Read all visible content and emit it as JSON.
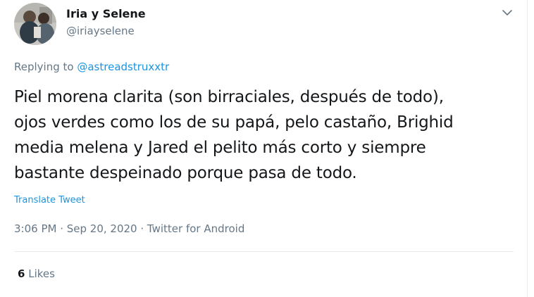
{
  "user": {
    "display_name": "Iria y Selene",
    "handle": "@iriayselene"
  },
  "reply": {
    "prefix": "Replying to",
    "mention": "@astreadstruxxtr"
  },
  "tweet": {
    "lines": [
      "Piel morena clarita (son birraciales, después de todo),",
      "ojos verdes como los de su papá, pelo castaño, Brighid",
      "media melena y Jared el pelito más corto y siempre",
      "bastante despeinado porque pasa de todo."
    ],
    "translate_label": "Translate Tweet"
  },
  "meta": {
    "time": "3:06 PM",
    "separator": " · ",
    "date": "Sep 20, 2020",
    "source": "Twitter for Android"
  },
  "stats": {
    "likes_count": "6",
    "likes_label": "Likes"
  },
  "colors": {
    "link": "#1b95e0",
    "secondary_text": "#657786",
    "primary_text": "#14171a",
    "divider": "#e6ecf0"
  },
  "icons": {
    "caret": "chevron-down-icon"
  }
}
